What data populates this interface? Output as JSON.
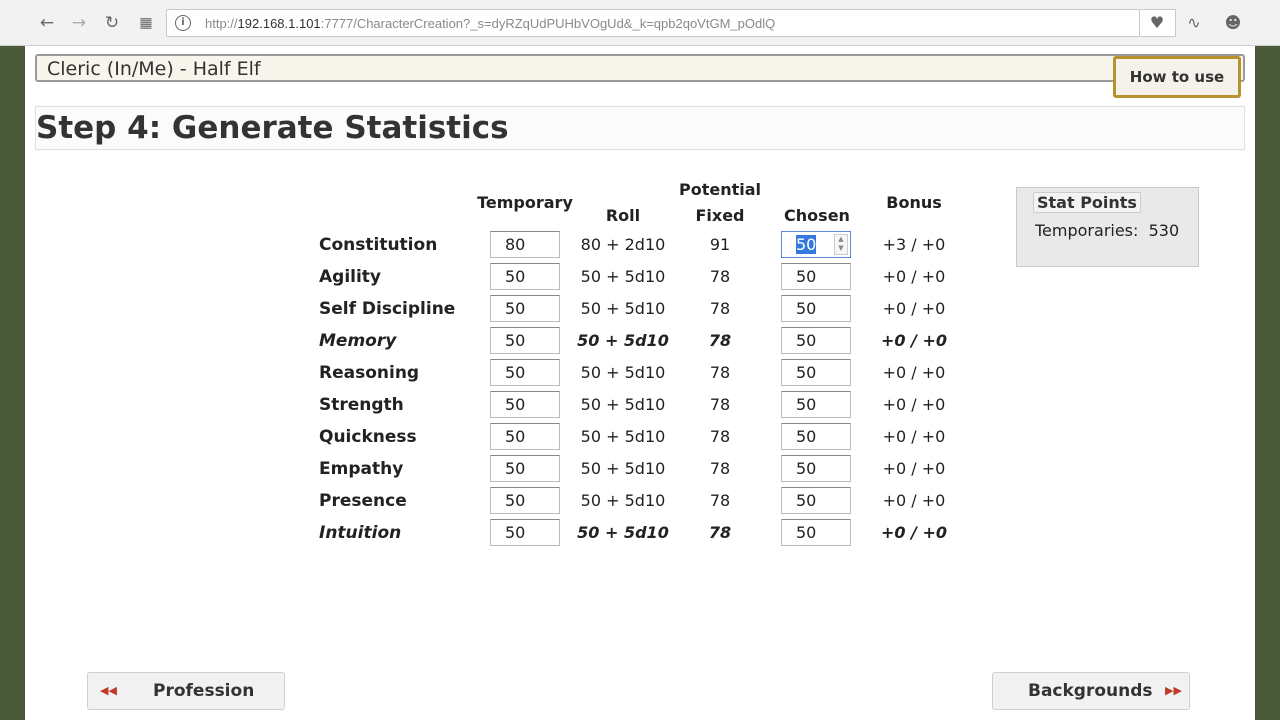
{
  "browser": {
    "url_prefix": "http://",
    "url_host": "192.168.1.101",
    "url_rest": ":7777/CharacterCreation?_s=dyRZqUdPUHbVOgUd&_k=qpb2qoVtGM_pOdlQ"
  },
  "character": {
    "title": "Cleric (In/Me) - Half Elf"
  },
  "help": {
    "how_to_use_label": "How to use"
  },
  "step": {
    "title": "Step 4: Generate Statistics"
  },
  "table": {
    "headers": {
      "temporary": "Temporary",
      "roll": "Roll",
      "potential": "Potential",
      "fixed": "Fixed",
      "chosen": "Chosen",
      "bonus": "Bonus"
    },
    "rows": [
      {
        "name": "Constitution",
        "temporary": "80",
        "roll": "80 + 2d10",
        "fixed": "91",
        "chosen": "50",
        "bonus": "+3 / +0"
      },
      {
        "name": "Agility",
        "temporary": "50",
        "roll": "50 + 5d10",
        "fixed": "78",
        "chosen": "50",
        "bonus": "+0 / +0"
      },
      {
        "name": "Self Discipline",
        "temporary": "50",
        "roll": "50 + 5d10",
        "fixed": "78",
        "chosen": "50",
        "bonus": "+0 / +0"
      },
      {
        "name": "Memory",
        "temporary": "50",
        "roll": "50 + 5d10",
        "fixed": "78",
        "chosen": "50",
        "bonus": "+0 / +0"
      },
      {
        "name": "Reasoning",
        "temporary": "50",
        "roll": "50 + 5d10",
        "fixed": "78",
        "chosen": "50",
        "bonus": "+0 / +0"
      },
      {
        "name": "Strength",
        "temporary": "50",
        "roll": "50 + 5d10",
        "fixed": "78",
        "chosen": "50",
        "bonus": "+0 / +0"
      },
      {
        "name": "Quickness",
        "temporary": "50",
        "roll": "50 + 5d10",
        "fixed": "78",
        "chosen": "50",
        "bonus": "+0 / +0"
      },
      {
        "name": "Empathy",
        "temporary": "50",
        "roll": "50 + 5d10",
        "fixed": "78",
        "chosen": "50",
        "bonus": "+0 / +0"
      },
      {
        "name": "Presence",
        "temporary": "50",
        "roll": "50 + 5d10",
        "fixed": "78",
        "chosen": "50",
        "bonus": "+0 / +0"
      },
      {
        "name": "Intuition",
        "temporary": "50",
        "roll": "50 + 5d10",
        "fixed": "78",
        "chosen": "50",
        "bonus": "+0 / +0"
      }
    ]
  },
  "stat_points": {
    "legend": "Stat Points",
    "label": "Temporaries:",
    "value": "530"
  },
  "footer": {
    "prev_label": "Profession",
    "next_label": "Backgrounds"
  },
  "colors": {
    "accent_border": "#b8922e",
    "arrow": "#c0392b"
  }
}
